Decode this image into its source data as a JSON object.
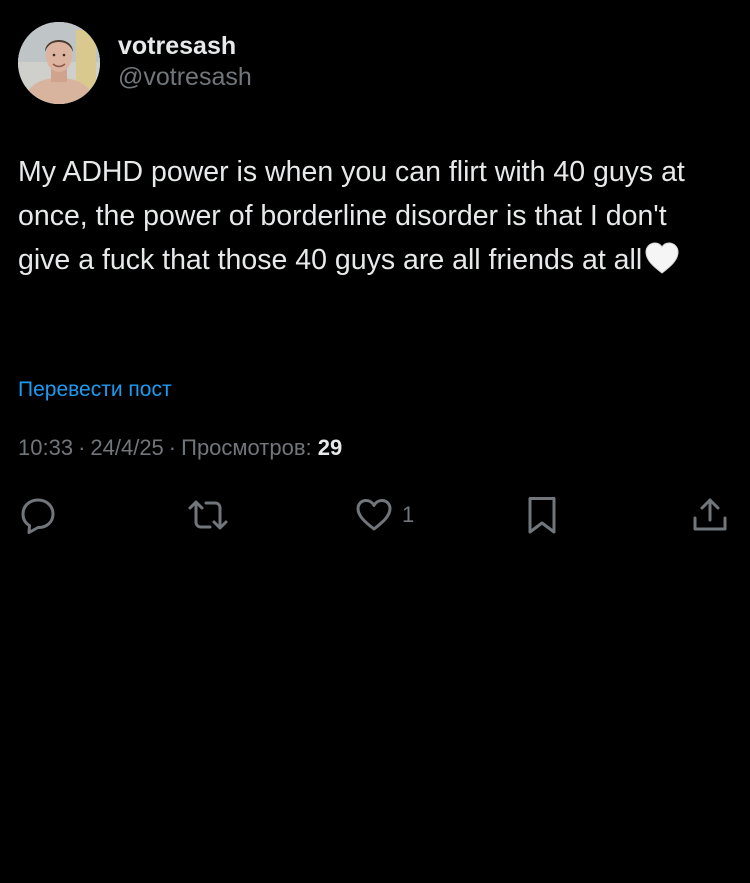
{
  "user": {
    "display_name": "votresash",
    "handle": "@votresash"
  },
  "tweet": {
    "text": "My ADHD power is when you can flirt with 40 guys at once, the power of borderline disorder is that I don't give a fuck that those 40 guys are all friends at all",
    "emoji": "white-heart"
  },
  "translate_link": "Перевести пост",
  "meta": {
    "time": "10:33",
    "date": "24/4/25",
    "views_label": "Просмотров:",
    "views_count": "29"
  },
  "actions": {
    "reply_icon": "speech-bubble-icon",
    "retweet_icon": "retweet-arrows-icon",
    "like_icon": "heart-outline-icon",
    "like_count": "1",
    "bookmark_icon": "bookmark-icon",
    "share_icon": "share-upload-icon"
  },
  "colors": {
    "background": "#000000",
    "text": "#e7e9ea",
    "secondary": "#71767b",
    "link": "#1d9bf0"
  }
}
